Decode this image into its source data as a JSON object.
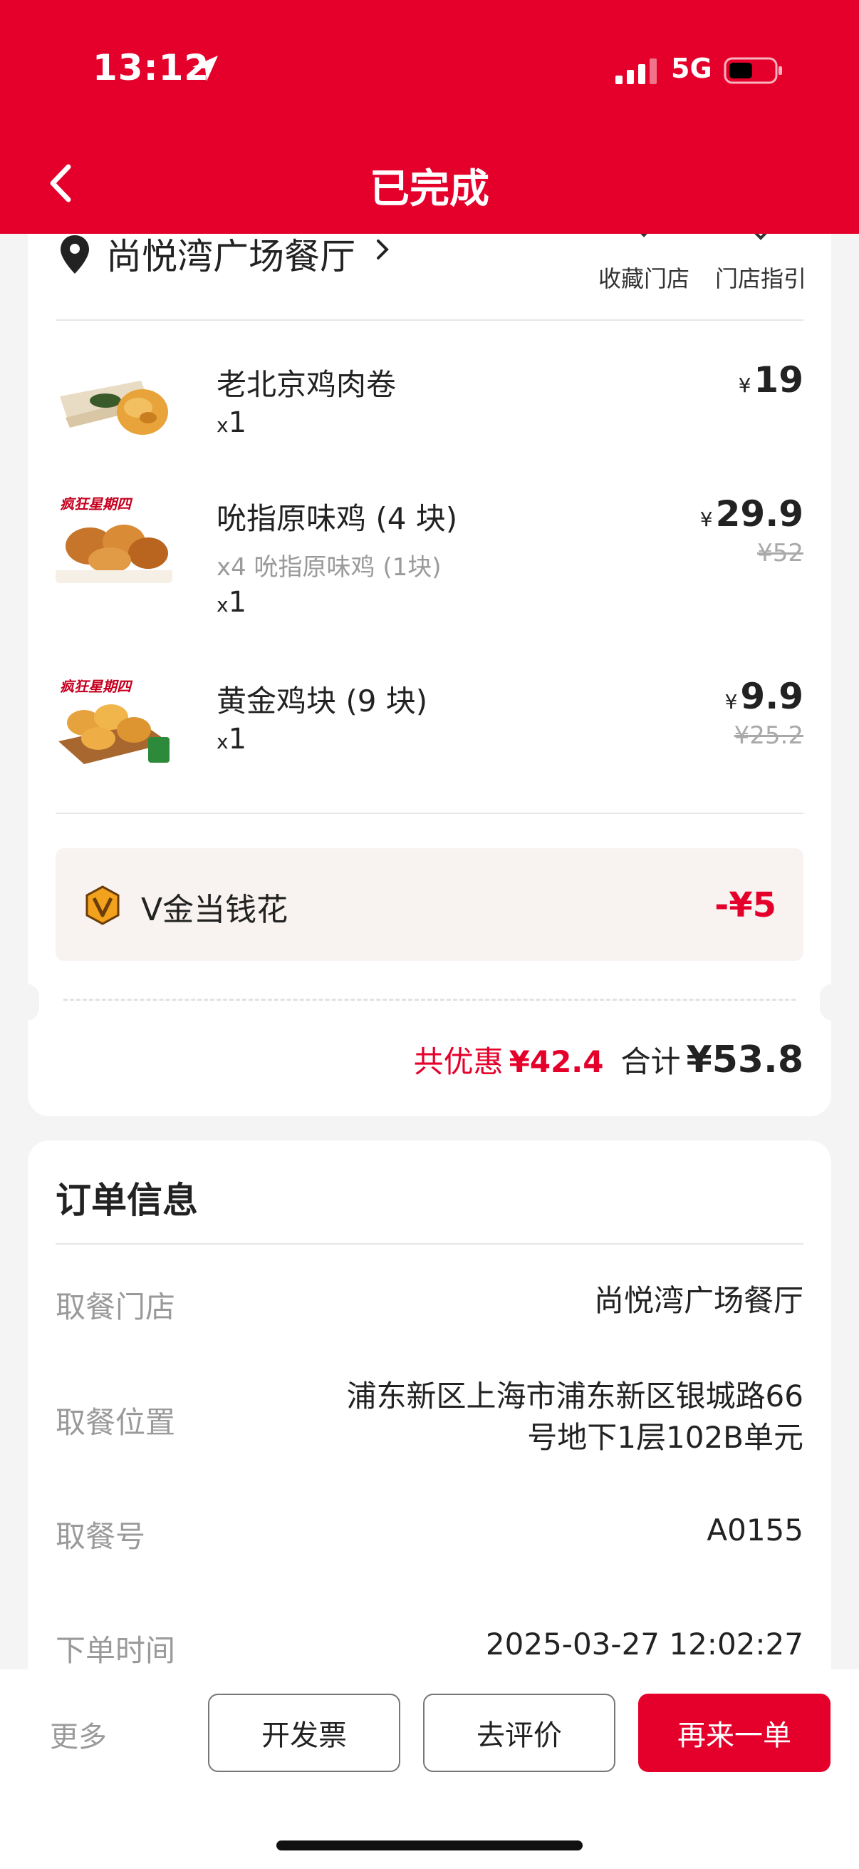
{
  "status_bar": {
    "time": "13:12",
    "network": "5G"
  },
  "header": {
    "title": "已完成"
  },
  "store": {
    "name": "尚悦湾广场餐厅",
    "actions": [
      {
        "label": "收藏门店",
        "icon": "heart-icon"
      },
      {
        "label": "门店指引",
        "icon": "location-guide-icon"
      }
    ]
  },
  "items": [
    {
      "name": "老北京鸡肉卷",
      "sub": "",
      "qty_prefix": "x",
      "qty": "1",
      "currency": "¥",
      "price": "19",
      "orig_price": ""
    },
    {
      "name": "吮指原味鸡 (4 块)",
      "sub": "x4 吮指原味鸡 (1块)",
      "qty_prefix": "x",
      "qty": "1",
      "currency": "¥",
      "price": "29.9",
      "orig_price": "¥52"
    },
    {
      "name": "黄金鸡块 (9 块)",
      "sub": "",
      "qty_prefix": "x",
      "qty": "1",
      "currency": "¥",
      "price": "9.9",
      "orig_price": "¥25.2"
    }
  ],
  "discount": {
    "label": "V金当钱花",
    "amount": "-¥5"
  },
  "summary": {
    "saved_label": "共优惠",
    "saved": "¥42.4",
    "total_label": "合计",
    "total": "¥53.8"
  },
  "order_info": {
    "title": "订单信息",
    "rows": [
      {
        "label": "取餐门店",
        "value": "尚悦湾广场餐厅"
      },
      {
        "label": "取餐位置",
        "value_line1": "浦东新区上海市浦东新区银城路66",
        "value_line2": "号地下1层102B单元"
      },
      {
        "label": "取餐号",
        "value": "A0155"
      },
      {
        "label": "下单时间",
        "value": "2025-03-27 12:02:27"
      }
    ]
  },
  "bottom_bar": {
    "more": "更多",
    "invoice": "开发票",
    "review": "去评价",
    "reorder": "再来一单"
  },
  "colors": {
    "brand": "#e4002b",
    "saved_text": "#e4002b"
  }
}
